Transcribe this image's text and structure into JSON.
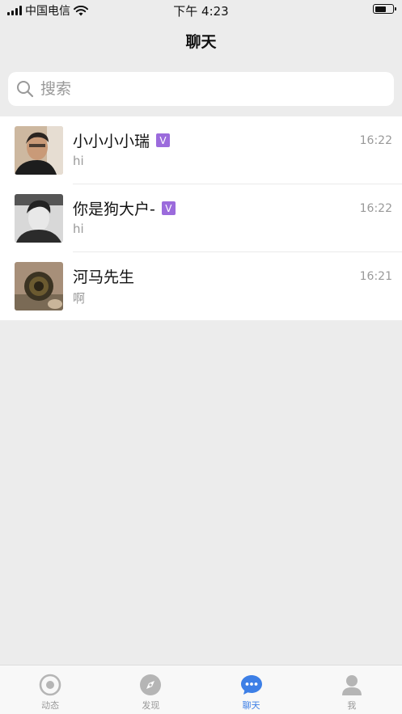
{
  "status_bar": {
    "carrier": "中国电信",
    "time": "下午 4:23",
    "battery_level": 0.65
  },
  "header": {
    "title": "聊天"
  },
  "search": {
    "placeholder": "搜索"
  },
  "chats": [
    {
      "name": "小小小小瑞",
      "vip": "V",
      "time": "16:22",
      "preview": "hi"
    },
    {
      "name": "你是狗大户-",
      "vip": "V",
      "time": "16:22",
      "preview": "hi"
    },
    {
      "name": "河马先生",
      "time": "16:21",
      "preview": "啊"
    }
  ],
  "tab_bar": {
    "items": [
      {
        "label": "动态",
        "icon": "target-icon"
      },
      {
        "label": "发现",
        "icon": "compass-icon"
      },
      {
        "label": "聊天",
        "icon": "chat-bubble-icon",
        "active": true
      },
      {
        "label": "我",
        "icon": "person-icon"
      }
    ]
  },
  "colors": {
    "accent": "#3d7fe6",
    "vip_badge": "#9b6bdc",
    "background": "#ececec"
  }
}
